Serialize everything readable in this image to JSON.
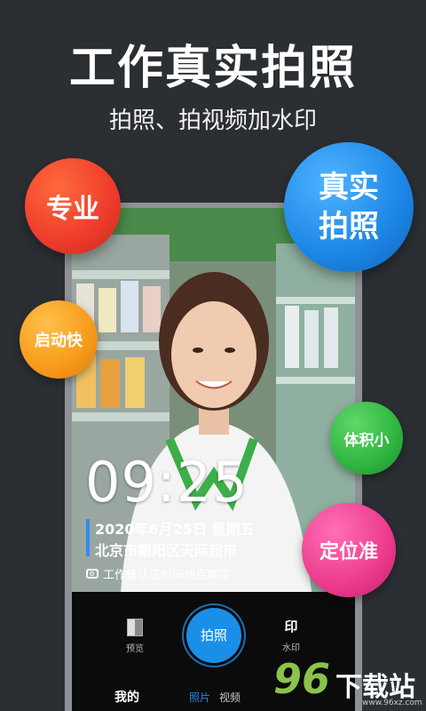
{
  "headline": "工作真实拍照",
  "subheadline": "拍照、拍视频加水印",
  "badges": {
    "pro": "专业",
    "real_line1": "真实",
    "real_line2": "拍照",
    "fast": "启动快",
    "small": "体积小",
    "location": "定位准"
  },
  "watermark": {
    "time": "09:25",
    "date": "2020年6月25日 星期五",
    "location": "北京市朝阳区天际超市",
    "certification": "工作蜂认证时间地点真实"
  },
  "controls": {
    "preview_label": "预览",
    "shutter_label": "拍照",
    "watermark_glyph": "印",
    "watermark_label": "水印"
  },
  "tabs": {
    "mine": "我的",
    "photo": "照片",
    "video": "视频"
  },
  "site_logo": {
    "number": "96",
    "text": "下载站",
    "url": "www.96xz.com"
  },
  "colors": {
    "background": "#2b2f33",
    "accent": "#1a8fe8",
    "pro": "#ee3b2b",
    "real": "#1c86e6",
    "fast": "#f79a1b",
    "small": "#2fb540",
    "location": "#ec3b8e"
  },
  "icons": [
    "camera-icon",
    "preview-thumbnail-icon"
  ]
}
